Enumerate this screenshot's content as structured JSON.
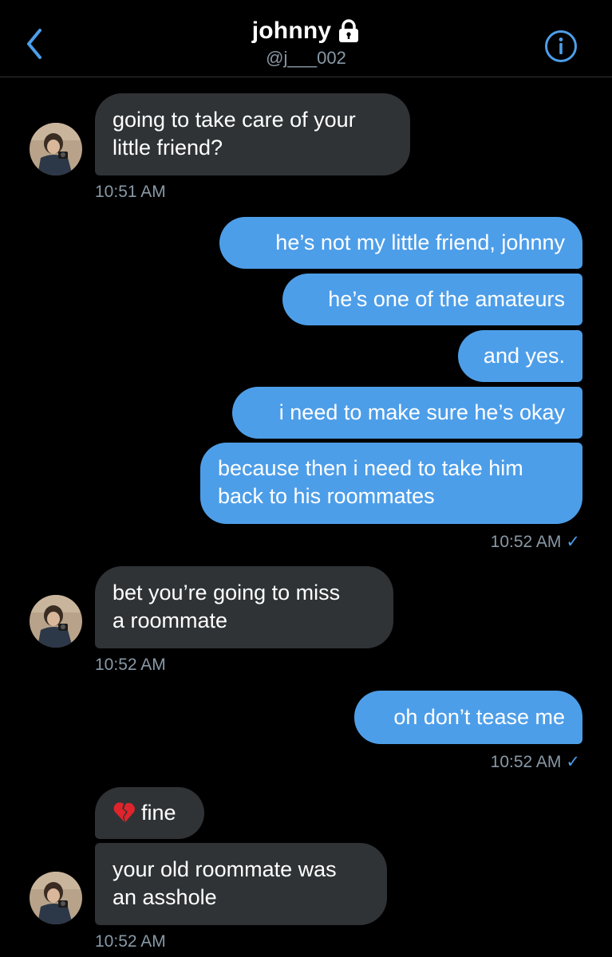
{
  "header": {
    "title": "johnny",
    "handle": "@j___002"
  },
  "colors": {
    "background": "#000000",
    "incoming_bubble": "#2f3336",
    "outgoing_bubble": "#4d9ee9",
    "accent": "#4d9ee9",
    "meta_text": "#8899a6"
  },
  "icons": {
    "back": "chevron-left-icon",
    "lock": "lock-icon",
    "info": "info-circle-icon",
    "sent_check": "checkmark-icon",
    "broken_heart": "broken-heart-emoji"
  },
  "messages": {
    "m1": "going to take care of your",
    "m1b": "little friend?",
    "t1": "10:51 AM",
    "m2": "he’s not my little friend, johnny",
    "m3": "he’s one of the amateurs",
    "m4": "and yes.",
    "m5": "i need to make sure he’s okay",
    "m6": "because then i need to take him",
    "m6b": "back to his roommates",
    "t2": "10:52 AM",
    "m7": "bet you’re going to miss",
    "m7b": "a roommate",
    "t3": "10:52 AM",
    "m8": "oh don’t tease me",
    "t4": "10:52 AM",
    "m9": "fine",
    "m10": "your old roommate was",
    "m10b": "an asshole",
    "t5": "10:52 AM"
  },
  "check_glyph": "✓"
}
